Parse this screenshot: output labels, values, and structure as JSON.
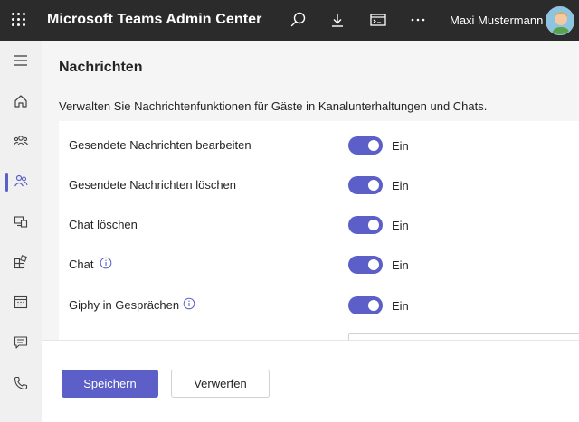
{
  "topbar": {
    "title": "Microsoft Teams Admin Center",
    "user_name": "Maxi Mustermann",
    "icons": [
      "waffle-icon",
      "search-icon",
      "download-icon",
      "terminal-icon",
      "more-icon"
    ]
  },
  "rail": {
    "items": [
      {
        "name": "menu",
        "icon": "hamburger-icon"
      },
      {
        "name": "dashboard",
        "icon": "home-icon"
      },
      {
        "name": "teams",
        "icon": "teams-icon"
      },
      {
        "name": "users",
        "icon": "users-icon",
        "active": true
      },
      {
        "name": "devices",
        "icon": "devices-icon"
      },
      {
        "name": "apps",
        "icon": "apps-icon"
      },
      {
        "name": "meetings",
        "icon": "calendar-icon"
      },
      {
        "name": "messaging",
        "icon": "chat-icon"
      },
      {
        "name": "voice",
        "icon": "phone-icon"
      }
    ]
  },
  "main": {
    "title": "Nachrichten",
    "description": "Verwalten Sie Nachrichtenfunktionen für Gäste in Kanalunterhaltungen und Chats.",
    "settings": [
      {
        "label": "Gesendete Nachrichten bearbeiten",
        "value": "Ein",
        "on": true,
        "info": false
      },
      {
        "label": "Gesendete Nachrichten löschen",
        "value": "Ein",
        "on": true,
        "info": false
      },
      {
        "label": "Chat löschen",
        "value": "Ein",
        "on": true,
        "info": false
      },
      {
        "label": "Chat",
        "value": "Ein",
        "on": true,
        "info": true
      },
      {
        "label": "Giphy in Gesprächen",
        "value": "Ein",
        "on": true,
        "info": true
      }
    ]
  },
  "footer": {
    "save_label": "Speichern",
    "discard_label": "Verwerfen"
  },
  "colors": {
    "accent": "#5b5fc7",
    "topbar": "#2b2b2b",
    "rail": "#f0f0f0",
    "page_bg": "#f5f5f5"
  }
}
